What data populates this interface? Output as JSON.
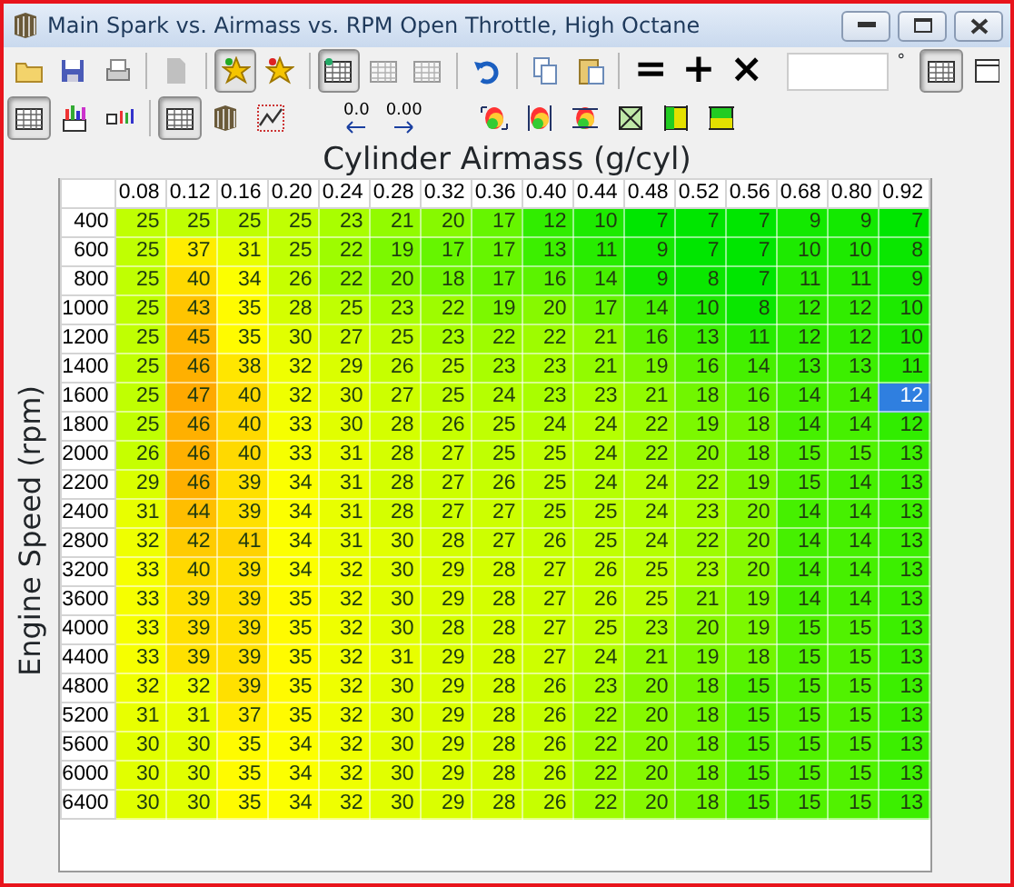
{
  "window": {
    "title": "Main Spark vs. Airmass vs. RPM Open Throttle, High Octane"
  },
  "toolbar_1": [
    {
      "kind": "icon",
      "pressed": false,
      "disabled": false
    },
    {
      "kind": "icon",
      "pressed": false,
      "disabled": false
    },
    {
      "kind": "icon",
      "pressed": false,
      "disabled": false
    },
    {
      "kind": "separator"
    },
    {
      "kind": "icon",
      "pressed": false,
      "disabled": true
    },
    {
      "kind": "separator"
    },
    {
      "kind": "icon",
      "pressed": true,
      "disabled": false
    },
    {
      "kind": "icon",
      "pressed": false,
      "disabled": false
    },
    {
      "kind": "separator"
    },
    {
      "kind": "icon",
      "pressed": true,
      "disabled": false
    },
    {
      "kind": "icon",
      "pressed": false,
      "disabled": true
    },
    {
      "kind": "icon",
      "pressed": false,
      "disabled": true
    },
    {
      "kind": "separator"
    },
    {
      "kind": "icon",
      "pressed": false,
      "disabled": false
    },
    {
      "kind": "separator"
    },
    {
      "kind": "icon",
      "pressed": false,
      "disabled": false
    },
    {
      "kind": "icon",
      "pressed": false,
      "disabled": false
    },
    {
      "kind": "separator"
    },
    {
      "kind": "glyph",
      "text": "="
    },
    {
      "kind": "glyph",
      "text": "+"
    },
    {
      "kind": "glyph",
      "text": "×"
    },
    {
      "kind": "field",
      "unit": "°"
    },
    {
      "kind": "spacer"
    },
    {
      "kind": "icon",
      "pressed": true,
      "disabled": false
    },
    {
      "kind": "icon",
      "pressed": false,
      "disabled": false
    }
  ],
  "toolbar_2": [
    {
      "kind": "icon",
      "pressed": true
    },
    {
      "kind": "icon",
      "pressed": false
    },
    {
      "kind": "icon",
      "pressed": false
    },
    {
      "kind": "separator"
    },
    {
      "kind": "icon",
      "pressed": true
    },
    {
      "kind": "icon",
      "pressed": false
    },
    {
      "kind": "icon",
      "pressed": false
    },
    {
      "kind": "gap"
    },
    {
      "kind": "decimal",
      "text": "0.0"
    },
    {
      "kind": "decimal",
      "text": "0.00"
    },
    {
      "kind": "gap"
    },
    {
      "kind": "icon",
      "pressed": false
    },
    {
      "kind": "icon",
      "pressed": false
    },
    {
      "kind": "icon",
      "pressed": false
    },
    {
      "kind": "icon",
      "pressed": false
    },
    {
      "kind": "icon",
      "pressed": false
    },
    {
      "kind": "icon",
      "pressed": false
    }
  ],
  "table": {
    "x_axis_title": "Cylinder Airmass (g/cyl)",
    "y_axis_title": "Engine Speed (rpm)",
    "columns": [
      "0.08",
      "0.12",
      "0.16",
      "0.20",
      "0.24",
      "0.28",
      "0.32",
      "0.36",
      "0.40",
      "0.44",
      "0.48",
      "0.52",
      "0.56",
      "0.68",
      "0.80",
      "0.92"
    ],
    "rows": [
      {
        "label": "400",
        "values": [
          "25",
          "25",
          "25",
          "25",
          "23",
          "21",
          "20",
          "17",
          "12",
          "10",
          "7",
          "7",
          "7",
          "9",
          "9",
          "7"
        ]
      },
      {
        "label": "600",
        "values": [
          "25",
          "37",
          "31",
          "25",
          "22",
          "19",
          "17",
          "17",
          "13",
          "11",
          "9",
          "7",
          "7",
          "10",
          "10",
          "8"
        ]
      },
      {
        "label": "800",
        "values": [
          "25",
          "40",
          "34",
          "26",
          "22",
          "20",
          "18",
          "17",
          "16",
          "14",
          "9",
          "8",
          "7",
          "11",
          "11",
          "9"
        ]
      },
      {
        "label": "1000",
        "values": [
          "25",
          "43",
          "35",
          "28",
          "25",
          "23",
          "22",
          "19",
          "20",
          "17",
          "14",
          "10",
          "8",
          "12",
          "12",
          "10"
        ]
      },
      {
        "label": "1200",
        "values": [
          "25",
          "45",
          "35",
          "30",
          "27",
          "25",
          "23",
          "22",
          "22",
          "21",
          "16",
          "13",
          "11",
          "12",
          "12",
          "10"
        ]
      },
      {
        "label": "1400",
        "values": [
          "25",
          "46",
          "38",
          "32",
          "29",
          "26",
          "25",
          "23",
          "23",
          "21",
          "19",
          "16",
          "14",
          "13",
          "13",
          "11"
        ]
      },
      {
        "label": "1600",
        "values": [
          "25",
          "47",
          "40",
          "32",
          "30",
          "27",
          "25",
          "24",
          "23",
          "23",
          "21",
          "18",
          "16",
          "14",
          "14",
          "12"
        ],
        "selected": [
          false,
          false,
          false,
          false,
          false,
          false,
          false,
          false,
          false,
          false,
          false,
          false,
          false,
          false,
          false,
          true
        ]
      },
      {
        "label": "1800",
        "values": [
          "25",
          "46",
          "40",
          "33",
          "30",
          "28",
          "26",
          "25",
          "24",
          "24",
          "22",
          "19",
          "18",
          "14",
          "14",
          "12"
        ]
      },
      {
        "label": "2000",
        "values": [
          "26",
          "46",
          "40",
          "33",
          "31",
          "28",
          "27",
          "25",
          "25",
          "24",
          "22",
          "20",
          "18",
          "15",
          "15",
          "13"
        ]
      },
      {
        "label": "2200",
        "values": [
          "29",
          "46",
          "39",
          "34",
          "31",
          "28",
          "27",
          "26",
          "25",
          "24",
          "24",
          "22",
          "19",
          "15",
          "14",
          "13"
        ]
      },
      {
        "label": "2400",
        "values": [
          "31",
          "44",
          "39",
          "34",
          "31",
          "28",
          "27",
          "27",
          "25",
          "25",
          "24",
          "23",
          "20",
          "14",
          "14",
          "13"
        ]
      },
      {
        "label": "2800",
        "values": [
          "32",
          "42",
          "41",
          "34",
          "31",
          "30",
          "28",
          "27",
          "26",
          "25",
          "24",
          "22",
          "20",
          "14",
          "14",
          "13"
        ]
      },
      {
        "label": "3200",
        "values": [
          "33",
          "40",
          "39",
          "34",
          "32",
          "30",
          "29",
          "28",
          "27",
          "26",
          "25",
          "23",
          "20",
          "14",
          "14",
          "13"
        ]
      },
      {
        "label": "3600",
        "values": [
          "33",
          "39",
          "39",
          "35",
          "32",
          "30",
          "29",
          "28",
          "27",
          "26",
          "25",
          "21",
          "19",
          "14",
          "14",
          "13"
        ]
      },
      {
        "label": "4000",
        "values": [
          "33",
          "39",
          "39",
          "35",
          "32",
          "30",
          "28",
          "28",
          "27",
          "25",
          "23",
          "20",
          "19",
          "15",
          "15",
          "13"
        ]
      },
      {
        "label": "4400",
        "values": [
          "33",
          "39",
          "39",
          "35",
          "32",
          "31",
          "29",
          "28",
          "27",
          "24",
          "21",
          "19",
          "18",
          "15",
          "15",
          "13"
        ]
      },
      {
        "label": "4800",
        "values": [
          "32",
          "32",
          "39",
          "35",
          "32",
          "30",
          "29",
          "28",
          "26",
          "23",
          "20",
          "18",
          "15",
          "15",
          "15",
          "13"
        ]
      },
      {
        "label": "5200",
        "values": [
          "31",
          "31",
          "37",
          "35",
          "32",
          "30",
          "29",
          "28",
          "26",
          "22",
          "20",
          "18",
          "15",
          "15",
          "15",
          "13"
        ]
      },
      {
        "label": "5600",
        "values": [
          "30",
          "30",
          "35",
          "34",
          "32",
          "30",
          "29",
          "28",
          "26",
          "22",
          "20",
          "18",
          "15",
          "15",
          "15",
          "13"
        ]
      },
      {
        "label": "6000",
        "values": [
          "30",
          "30",
          "35",
          "34",
          "32",
          "30",
          "29",
          "28",
          "26",
          "22",
          "20",
          "18",
          "15",
          "15",
          "15",
          "13"
        ]
      },
      {
        "label": "6400",
        "values": [
          "30",
          "30",
          "35",
          "34",
          "32",
          "30",
          "29",
          "28",
          "26",
          "22",
          "20",
          "18",
          "15",
          "15",
          "15",
          "13"
        ]
      }
    ]
  }
}
